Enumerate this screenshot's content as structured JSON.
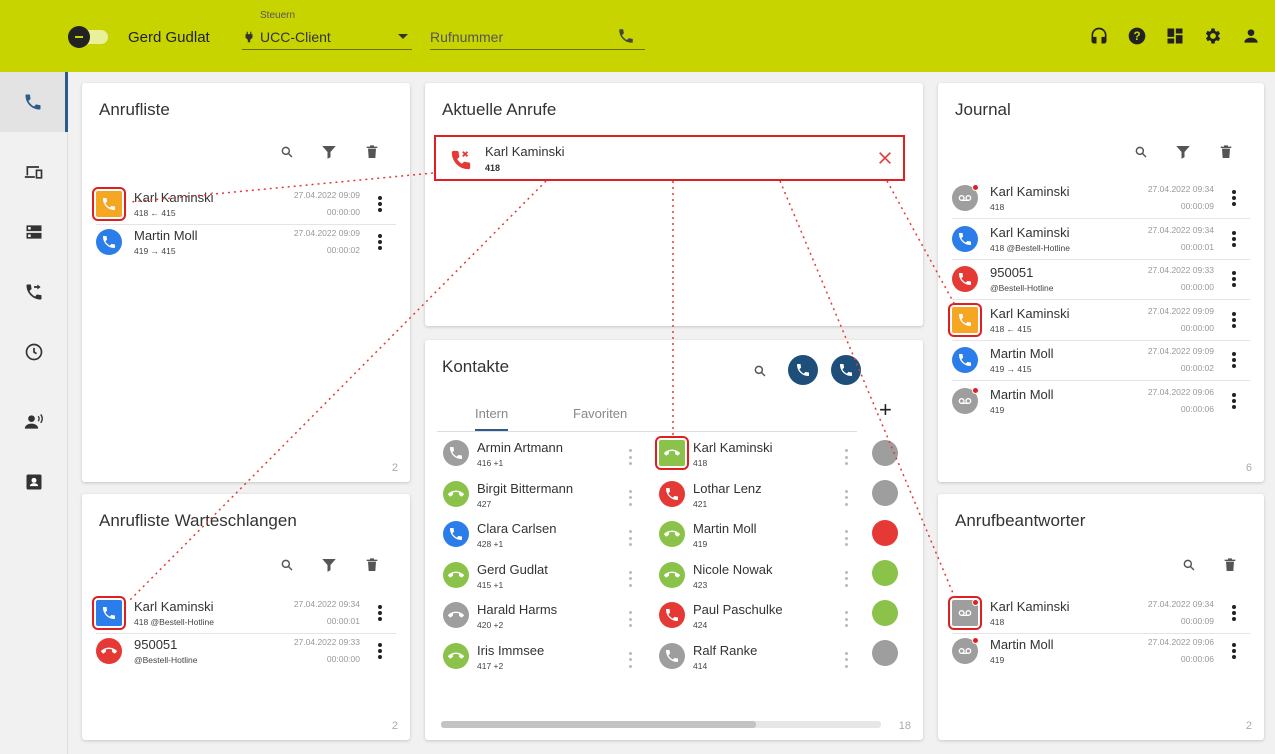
{
  "header": {
    "user_name": "Gerd Gudlat",
    "steuern_label": "Steuern",
    "client_select": "UCC-Client",
    "phone_placeholder": "Rufnummer"
  },
  "colors": {
    "accent": "#c8d400",
    "orange": "#f5a623",
    "blue": "#2b7de9",
    "red": "#e53935",
    "green": "#8bc34a",
    "gray": "#9e9e9e",
    "navy": "#1e4f7a"
  },
  "anrufliste": {
    "title": "Anrufliste",
    "count": "2",
    "rows": [
      {
        "name": "Karl Kaminski",
        "sub": "418 ← 415",
        "date": "27.04.2022 09:09",
        "dur": "00:00:00"
      },
      {
        "name": "Martin Moll",
        "sub": "419 → 415",
        "date": "27.04.2022 09:09",
        "dur": "00:00:02"
      }
    ]
  },
  "warteschlangen": {
    "title": "Anrufliste Warteschlangen",
    "count": "2",
    "rows": [
      {
        "name": "Karl Kaminski",
        "sub": "418 @Bestell-Hotline",
        "date": "27.04.2022 09:34",
        "dur": "00:00:01"
      },
      {
        "name": "950051",
        "sub": "@Bestell-Hotline",
        "date": "27.04.2022 09:33",
        "dur": "00:00:00"
      }
    ]
  },
  "aktuelle": {
    "title": "Aktuelle Anrufe",
    "call": {
      "name": "Karl Kaminski",
      "number": "418"
    }
  },
  "kontakte": {
    "title": "Kontakte",
    "tab_intern": "Intern",
    "tab_favoriten": "Favoriten",
    "count": "18",
    "col1": [
      {
        "name": "Armin Artmann",
        "sub": "416 +1"
      },
      {
        "name": "Birgit Bittermann",
        "sub": "427"
      },
      {
        "name": "Clara Carlsen",
        "sub": "428 +1"
      },
      {
        "name": "Gerd Gudlat",
        "sub": "415 +1"
      },
      {
        "name": "Harald Harms",
        "sub": "420 +2"
      },
      {
        "name": "Iris Immsee",
        "sub": "417 +2"
      }
    ],
    "col2": [
      {
        "name": "Karl Kaminski",
        "sub": "418"
      },
      {
        "name": "Lothar Lenz",
        "sub": "421"
      },
      {
        "name": "Martin Moll",
        "sub": "419"
      },
      {
        "name": "Nicole Nowak",
        "sub": "423"
      },
      {
        "name": "Paul Paschulke",
        "sub": "424"
      },
      {
        "name": "Ralf Ranke",
        "sub": "414"
      }
    ]
  },
  "journal": {
    "title": "Journal",
    "count": "6",
    "rows": [
      {
        "name": "Karl Kaminski",
        "sub": "418",
        "date": "27.04.2022 09:34",
        "dur": "00:00:09"
      },
      {
        "name": "Karl Kaminski",
        "sub": "418 @Bestell-Hotline",
        "date": "27.04.2022 09:34",
        "dur": "00:00:01"
      },
      {
        "name": "950051",
        "sub": "@Bestell-Hotline",
        "date": "27.04.2022 09:33",
        "dur": "00:00:00"
      },
      {
        "name": "Karl Kaminski",
        "sub": "418 ← 415",
        "date": "27.04.2022 09:09",
        "dur": "00:00:00"
      },
      {
        "name": "Martin Moll",
        "sub": "419 → 415",
        "date": "27.04.2022 09:09",
        "dur": "00:00:02"
      },
      {
        "name": "Martin Moll",
        "sub": "419",
        "date": "27.04.2022 09:06",
        "dur": "00:00:06"
      }
    ]
  },
  "anrufbeantworter": {
    "title": "Anrufbeantworter",
    "count": "2",
    "rows": [
      {
        "name": "Karl Kaminski",
        "sub": "418",
        "date": "27.04.2022 09:34",
        "dur": "00:00:09"
      },
      {
        "name": "Martin Moll",
        "sub": "419",
        "date": "27.04.2022 09:06",
        "dur": "00:00:06"
      }
    ]
  }
}
